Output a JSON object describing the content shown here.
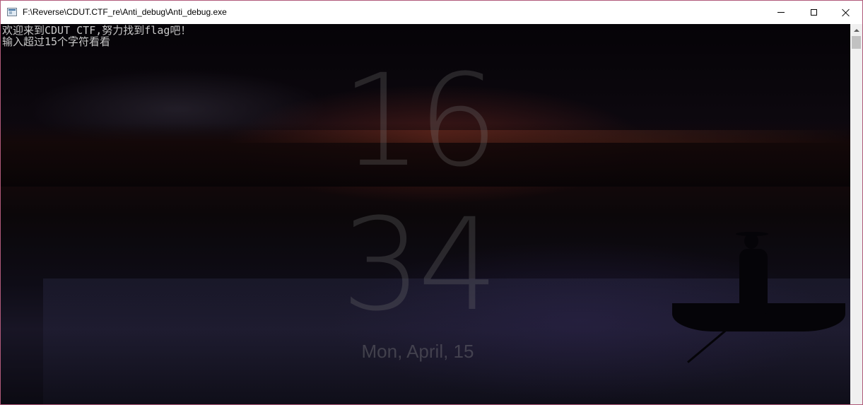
{
  "window": {
    "title": "F:\\Reverse\\CDUT.CTF_re\\Anti_debug\\Anti_debug.exe"
  },
  "console": {
    "lines": [
      "欢迎来到CDUT_CTF,努力找到flag吧！",
      "输入超过15个字符看看"
    ]
  },
  "wallpaper": {
    "clock_hour": "16",
    "clock_minute": "34",
    "date": "Mon, April, 15"
  },
  "icons": {
    "app": "console-app-icon",
    "minimize": "minimize-icon",
    "maximize": "maximize-icon",
    "close": "close-icon",
    "scroll_up": "chevron-up-icon"
  },
  "colors": {
    "titlebar": "#ffffff",
    "console_text": "#c8c8c8",
    "window_border": "#b05a7a"
  }
}
